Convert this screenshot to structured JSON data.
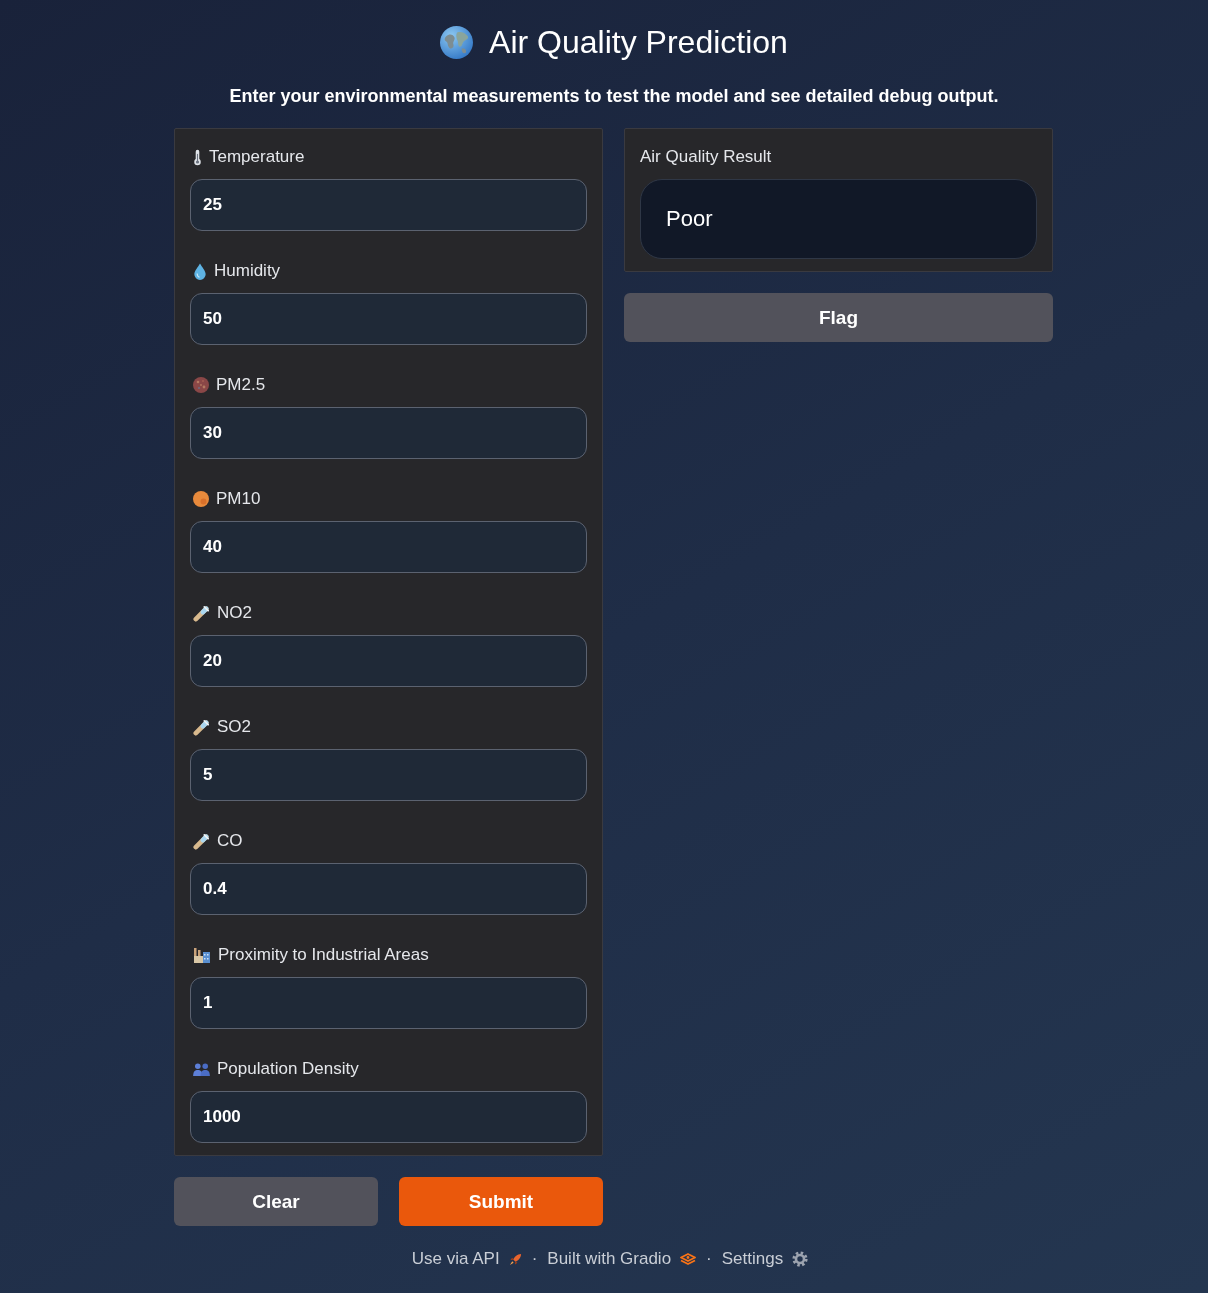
{
  "header": {
    "title": "Air Quality Prediction",
    "subtitle": "Enter your environmental measurements to test the model and see detailed debug output."
  },
  "inputs": [
    {
      "label": "Temperature",
      "value": "25"
    },
    {
      "label": "Humidity",
      "value": "50"
    },
    {
      "label": "PM2.5",
      "value": "30"
    },
    {
      "label": "PM10",
      "value": "40"
    },
    {
      "label": "NO2",
      "value": "20"
    },
    {
      "label": "SO2",
      "value": "5"
    },
    {
      "label": "CO",
      "value": "0.4"
    },
    {
      "label": "Proximity to Industrial Areas",
      "value": "1"
    },
    {
      "label": "Population Density",
      "value": "1000"
    }
  ],
  "output": {
    "label": "Air Quality Result",
    "value": "Poor"
  },
  "output_buttons": [
    {
      "label": "Flag",
      "kind": "secondary"
    }
  ],
  "actions": [
    {
      "label": "Clear",
      "kind": "secondary"
    },
    {
      "label": "Submit",
      "kind": "primary"
    }
  ],
  "footer": {
    "links": [
      {
        "label": "Use via API"
      },
      {
        "label": "Built with Gradio"
      },
      {
        "label": "Settings"
      }
    ],
    "separators": [
      "·",
      "·"
    ]
  }
}
